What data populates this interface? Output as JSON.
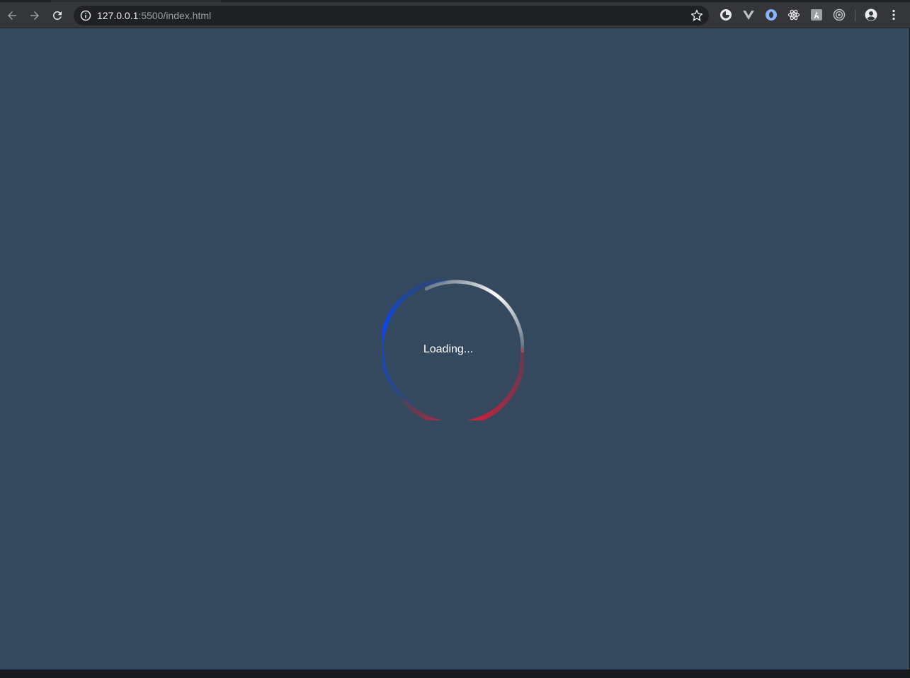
{
  "browser": {
    "url_host": "127.0.0.1",
    "url_rest": ":5500/index.html",
    "extensions": [
      "globe-extension-icon",
      "vue-devtools-icon",
      "circle-extension-icon",
      "react-devtools-icon",
      "a-extension-icon",
      "target-extension-icon"
    ],
    "account_icon": "account-icon",
    "menu_icon": "kebab-menu-icon"
  },
  "page": {
    "background": "#34495e",
    "loader_text": "Loading...",
    "loader_colors": {
      "top_right": "#ffffff",
      "left": "#0d47e8",
      "bottom": "#ef1530"
    }
  }
}
